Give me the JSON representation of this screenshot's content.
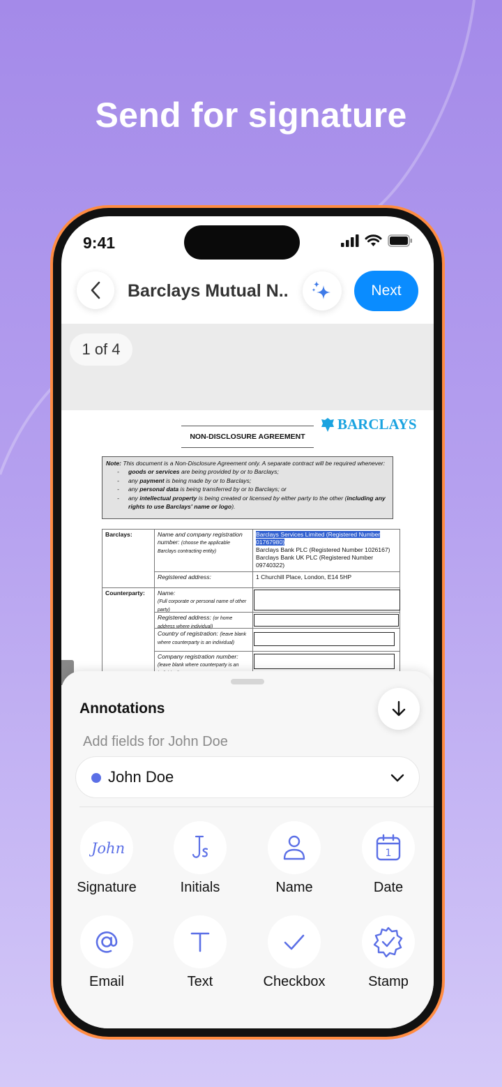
{
  "headline": "Send for signature",
  "status_bar": {
    "time": "9:41"
  },
  "nav": {
    "doc_title": "Barclays Mutual N...",
    "next_label": "Next"
  },
  "viewer": {
    "page_counter": "1 of 4"
  },
  "document": {
    "logo_text": "BARCLAYS",
    "title": "NON-DISCLOSURE AGREEMENT",
    "note": {
      "intro_label": "Note:",
      "intro": " This document is a Non-Disclosure Agreement only. A separate contract will be required whenever:",
      "items": [
        {
          "bold": "goods or services",
          "rest": " are being provided by or to Barclays;"
        },
        {
          "pre": "any ",
          "bold": "payment",
          "rest": " is being made by or to Barclays;"
        },
        {
          "pre": "any ",
          "bold": "personal data",
          "rest": " is being transferred by or to Barclays; or"
        },
        {
          "pre": "any ",
          "bold": "intellectual property",
          "rest": " is being created or licensed by either party to the other (",
          "bold2": "including any rights to use Barclays' name or logo",
          "rest2": ")."
        }
      ]
    },
    "table": {
      "barclays_label": "Barclays:",
      "name_reg_label": "Name and company registration number:",
      "name_reg_hint": "(choose the applicable Barclays contracting entity)",
      "entities": [
        "Barclays Services Limited (Registered Number 01767980)",
        "Barclays Bank PLC (Registered Number 1026167)",
        "Barclays Bank UK PLC (Registered Number 09740322)"
      ],
      "registered_address_label": "Registered address:",
      "registered_address_value": "1 Churchill Place, London, E14 5HP",
      "counterparty_label": "Counterparty:",
      "cp_name_label": "Name:",
      "cp_name_hint": "(Full corporate or personal name of other party)",
      "cp_address_label": "Registered address:",
      "cp_address_hint": "(or home address where individual)",
      "cp_country_label": "Country of registration:",
      "cp_country_hint": "(leave blank where counterparty is an individual)",
      "cp_company_label": "Company registration number:",
      "cp_company_hint": "(leave blank where counterparty is an individual)"
    }
  },
  "sheet": {
    "title": "Annotations",
    "subtitle": "Add fields for John Doe",
    "signer": {
      "name": "John Doe",
      "color": "#5b6fe6"
    },
    "tools": [
      {
        "label": "Signature",
        "icon": "signature-icon",
        "glyph": "John"
      },
      {
        "label": "Initials",
        "icon": "initials-icon"
      },
      {
        "label": "Name",
        "icon": "person-icon"
      },
      {
        "label": "Date",
        "icon": "calendar-icon",
        "glyph": "1"
      },
      {
        "label": "Email",
        "icon": "at-icon"
      },
      {
        "label": "Text",
        "icon": "text-icon",
        "glyph": "T"
      },
      {
        "label": "Checkbox",
        "icon": "checkmark-icon"
      },
      {
        "label": "Stamp",
        "icon": "stamp-icon"
      }
    ]
  },
  "colors": {
    "accent_blue": "#0a8cff",
    "icon_blue": "#5b6fe6",
    "frame_orange": "#ff8c42",
    "background_purple": "#a48ae9"
  }
}
